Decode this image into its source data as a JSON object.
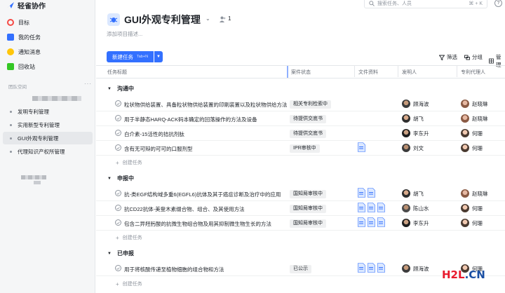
{
  "app": {
    "name": "轻雀协作"
  },
  "nav": [
    {
      "label": "目标",
      "icon": "target-icon",
      "color": "#f54a45"
    },
    {
      "label": "我的任务",
      "icon": "task-icon",
      "color": "#3370ff"
    },
    {
      "label": "通知消息",
      "icon": "bell-icon",
      "color": "#ffc60a"
    },
    {
      "label": "回收站",
      "icon": "trash-icon",
      "color": "#34c724"
    }
  ],
  "sidebar": {
    "section_label": "团队空间",
    "more": "···",
    "projects": [
      {
        "label": "发明专利管理"
      },
      {
        "label": "实用新型专利管理"
      },
      {
        "label": "GUI外观专利管理"
      },
      {
        "label": "代理知识产权所管理"
      }
    ]
  },
  "search": {
    "placeholder": "搜索任务、人员",
    "shortcut": "⌘ + K"
  },
  "help": "?",
  "project": {
    "title": "GUI外观专利管理",
    "member_count": "1",
    "description_placeholder": "添加项目描述..."
  },
  "toolbar": {
    "new_task": "新建任务",
    "new_task_hint": "Tab+N",
    "filter": "筛选",
    "group": "分组",
    "manage": "管理"
  },
  "columns": {
    "title": "任务标题",
    "status": "案件状态",
    "files": "文件资料",
    "inventor": "发明人",
    "agent": "专利代理人"
  },
  "groups": [
    {
      "name": "沟通中",
      "create": "创建任务",
      "rows": [
        {
          "title": "粒状物供给装置、具备粒状物供给装置的印刷装置以及粒状物供给方法",
          "status": "相关专利检索中",
          "files": 0,
          "inventor": "顾海波",
          "agent": "赵晓琳"
        },
        {
          "title": "用于半静态HARQ-ACK码本确定的回落操作的方法及设备",
          "status": "待提供交底书",
          "files": 0,
          "inventor": "胡飞",
          "agent": "赵晓琳"
        },
        {
          "title": "白介素-15活性的拮抗剂肽",
          "status": "待提供交底书",
          "files": 0,
          "inventor": "李东升",
          "agent": "何珊"
        },
        {
          "title": "含有无可辩的可可的口服剂型",
          "status": "IPR审核中",
          "files": 1,
          "inventor": "刘文",
          "agent": "何珊"
        }
      ]
    },
    {
      "name": "申报中",
      "create": "创建任务",
      "rows": [
        {
          "title": "抗-类EGF结构域多重6(EGFL6)抗体及其于癌症诊断及治疗中的应用",
          "status": "国知局审核中",
          "files": 2,
          "inventor": "胡飞",
          "agent": "赵晓琳"
        },
        {
          "title": "抗CD22抗体-美登木素缀合物、组合、及其使用方法",
          "status": "国知局审核中",
          "files": 3,
          "inventor": "陈山水",
          "agent": "何珊"
        },
        {
          "title": "包含二异羟肟酸的抗微生物组合物及用其抑制微生物生长的方法",
          "status": "国知局审核中",
          "files": 3,
          "inventor": "李东升",
          "agent": "何珊"
        }
      ]
    },
    {
      "name": "已申报",
      "create": "创建任务",
      "rows": [
        {
          "title": "用于将核酸传递至植物细胞的组合物和方法",
          "status": "已公示",
          "files": 3,
          "inventor": "顾海波",
          "agent": "何珊"
        }
      ]
    }
  ],
  "watermark": {
    "part1": "H2L",
    "part2": ".CN"
  }
}
